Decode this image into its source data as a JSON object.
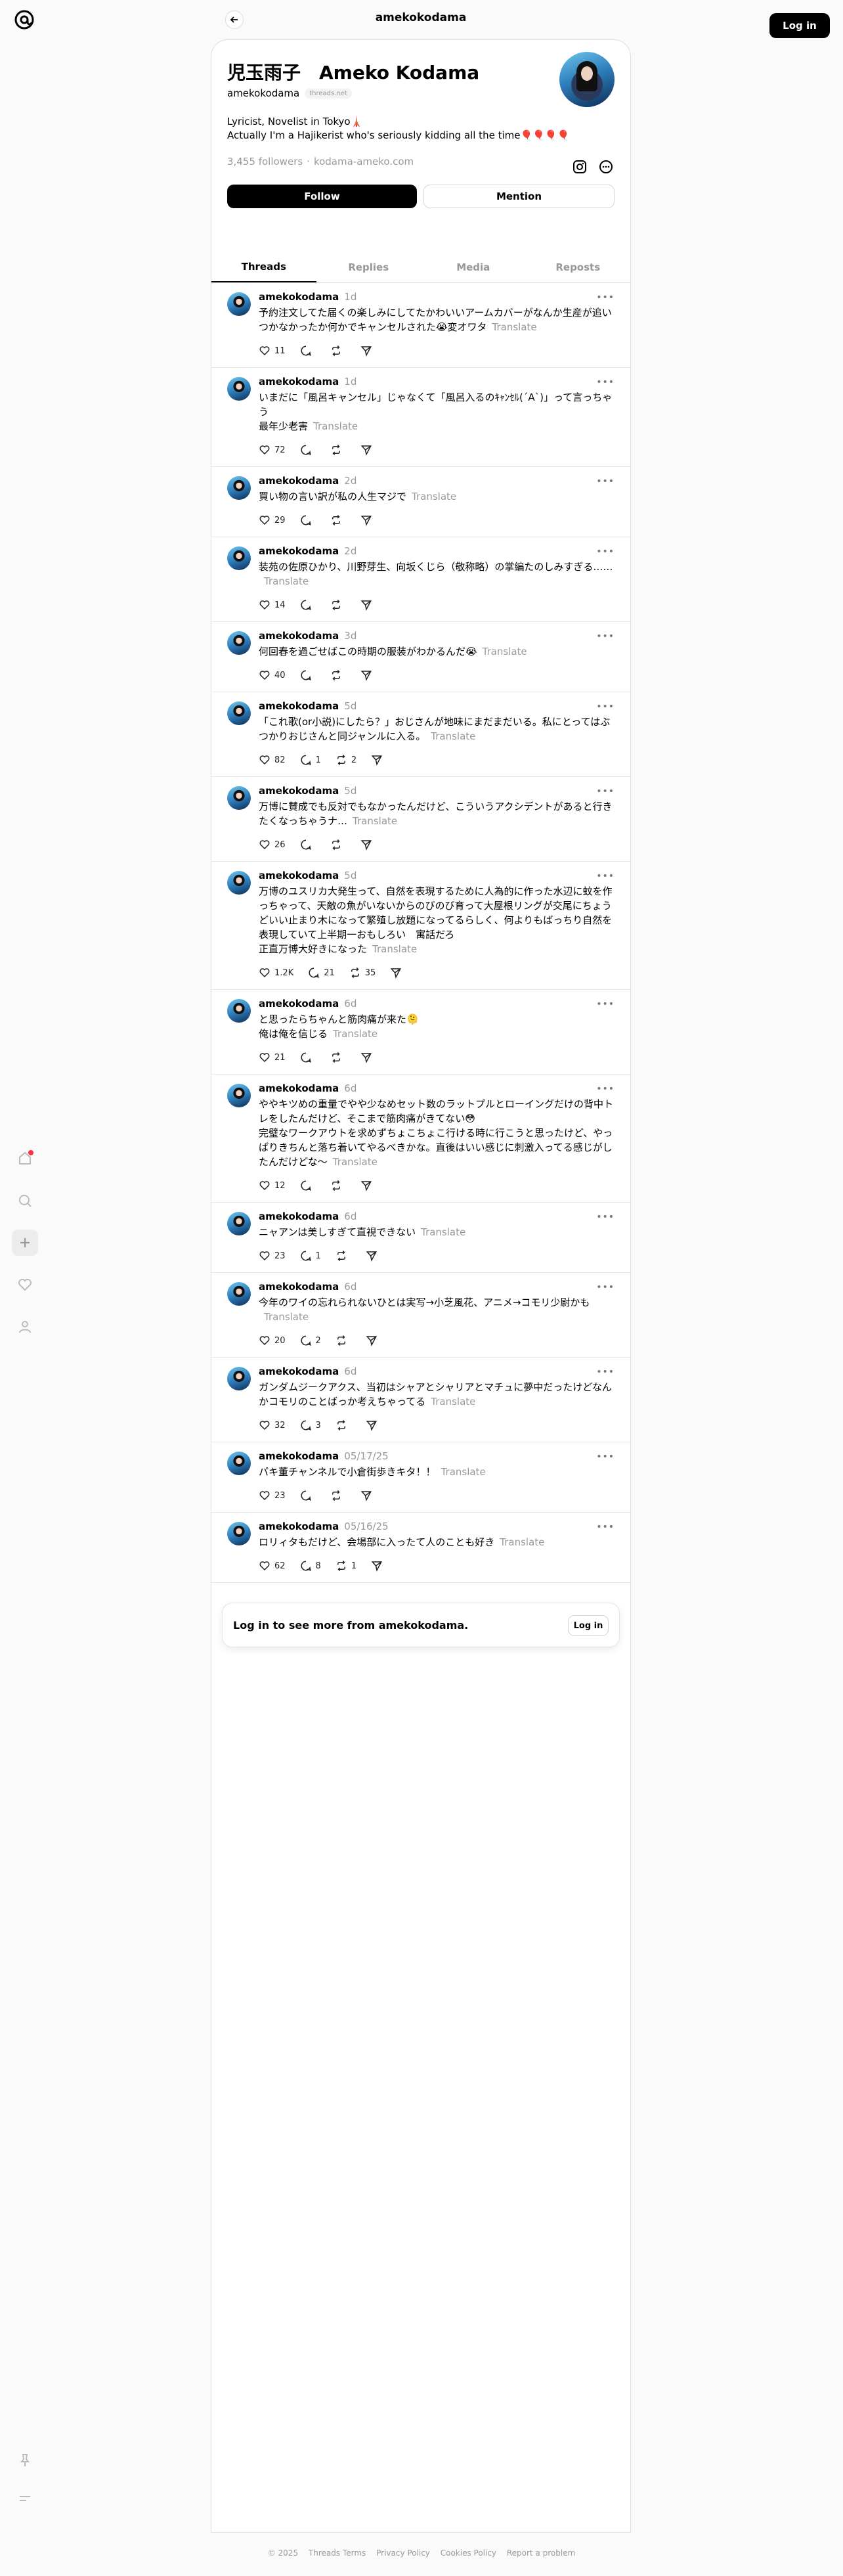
{
  "header": {
    "title": "amekokodama",
    "login_label": "Log in"
  },
  "profile": {
    "name": "児玉雨子　Ameko Kodama",
    "handle": "amekokodama",
    "domain_badge": "threads.net",
    "bio_line1": "Lyricist, Novelist in Tokyo🗼",
    "bio_line2": "Actually I'm a Hajikerist who's seriously kidding all the time🎈🎈🎈🎈",
    "followers": "3,455 followers",
    "separator": "·",
    "link": "kodama-ameko.com",
    "follow_label": "Follow",
    "mention_label": "Mention"
  },
  "tabs": [
    "Threads",
    "Replies",
    "Media",
    "Reposts"
  ],
  "translate_label": "Translate",
  "posts": [
    {
      "author": "amekokodama",
      "time": "1d",
      "text": "予約注文してた届くの楽しみにしてたかわいいアームカバーがなんか生産が追いつかなかったか何かでキャンセルされた😭変オワタ",
      "likes": "11",
      "replies": "",
      "reposts": ""
    },
    {
      "author": "amekokodama",
      "time": "1d",
      "text": "いまだに「風呂キャンセル」じゃなくて「風呂入るのｷｬﾝｾﾙ(´A`)」って言っちゃう\n最年少老害",
      "likes": "72",
      "replies": "",
      "reposts": ""
    },
    {
      "author": "amekokodama",
      "time": "2d",
      "text": "買い物の言い訳が私の人生マジで",
      "likes": "29",
      "replies": "",
      "reposts": ""
    },
    {
      "author": "amekokodama",
      "time": "2d",
      "text": "装苑の佐原ひかり、川野芽生、向坂くじら（敬称略）の掌編たのしみすぎる……",
      "likes": "14",
      "replies": "",
      "reposts": ""
    },
    {
      "author": "amekokodama",
      "time": "3d",
      "text": "何回春を過ごせばこの時期の服装がわかるんだ😭",
      "likes": "40",
      "replies": "",
      "reposts": ""
    },
    {
      "author": "amekokodama",
      "time": "5d",
      "text": "「これ歌(or小説)にしたら？」おじさんが地味にまだまだいる。私にとってはぶつかりおじさんと同ジャンルに入る。",
      "likes": "82",
      "replies": "1",
      "reposts": "2"
    },
    {
      "author": "amekokodama",
      "time": "5d",
      "text": "万博に賛成でも反対でもなかったんだけど、こういうアクシデントがあると行きたくなっちゃうナ…",
      "likes": "26",
      "replies": "",
      "reposts": ""
    },
    {
      "author": "amekokodama",
      "time": "5d",
      "text": "万博のユスリカ大発生って、自然を表現するために人為的に作った水辺に蚊を作っちゃって、天敵の魚がいないからのびのび育って大屋根リングが交尾にちょうどいい止まり木になって繁殖し放題になってるらしく、何よりもばっちり自然を表現していて上半期一おもしろい　寓話だろ\n正直万博大好きになった",
      "likes": "1.2K",
      "replies": "21",
      "reposts": "35"
    },
    {
      "author": "amekokodama",
      "time": "6d",
      "text": "と思ったらちゃんと筋肉痛が来た🫠\n俺は俺を信じる",
      "likes": "21",
      "replies": "",
      "reposts": ""
    },
    {
      "author": "amekokodama",
      "time": "6d",
      "text": "ややキツめの重量でやや少なめセット数のラットプルとローイングだけの背中トレをしたんだけど、そこまで筋肉痛がきてない😳\n完璧なワークアウトを求めずちょこちょこ行ける時に行こうと思ったけど、やっぱりきちんと落ち着いてやるべきかな。直後はいい感じに刺激入ってる感じがしたんだけどな〜",
      "likes": "12",
      "replies": "",
      "reposts": ""
    },
    {
      "author": "amekokodama",
      "time": "6d",
      "text": "ニャアンは美しすぎて直視できない",
      "likes": "23",
      "replies": "1",
      "reposts": ""
    },
    {
      "author": "amekokodama",
      "time": "6d",
      "text": "今年のワイの忘れられないひとは実写→小芝風花、アニメ→コモリ少尉かも",
      "likes": "20",
      "replies": "2",
      "reposts": ""
    },
    {
      "author": "amekokodama",
      "time": "6d",
      "text": "ガンダムジークアクス、当初はシャアとシャリアとマチュに夢中だったけどなんかコモリのことばっか考えちゃってる",
      "likes": "32",
      "replies": "3",
      "reposts": ""
    },
    {
      "author": "amekokodama",
      "time": "05/17/25",
      "text": "パキ董チャンネルで小倉街歩きキタ！！",
      "likes": "23",
      "replies": "",
      "reposts": ""
    },
    {
      "author": "amekokodama",
      "time": "05/16/25",
      "text": "ロリィタもだけど、会場部に入ったて人のことも好き",
      "likes": "62",
      "replies": "8",
      "reposts": "1"
    }
  ],
  "login_prompt": {
    "text": "Log in to see more from amekokodama.",
    "button": "Log in"
  },
  "footer": [
    "© 2025",
    "Threads Terms",
    "Privacy Policy",
    "Cookies Policy",
    "Report a problem"
  ],
  "colors": {
    "accent": "#000000",
    "muted": "#999999",
    "notification": "#ff3040"
  }
}
